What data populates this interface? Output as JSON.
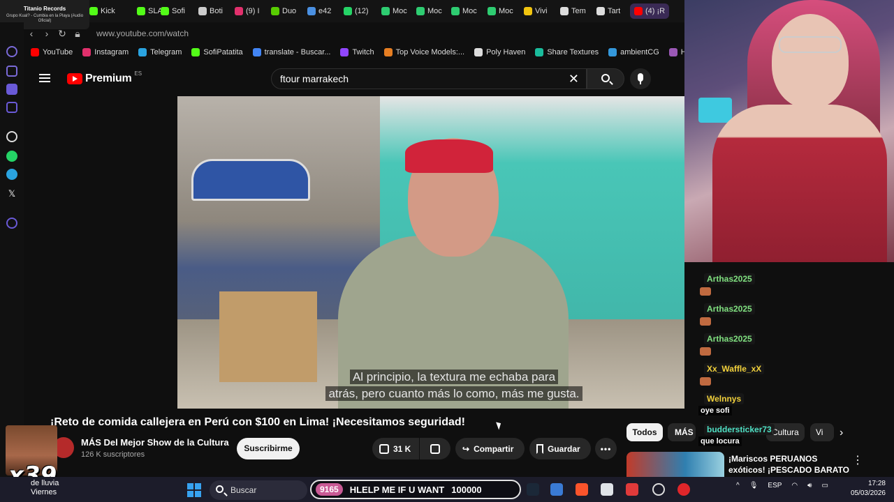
{
  "media_widget": {
    "title": "Titanio Records",
    "subtitle": "Grupo Kual? - Cumbia en la Playa (Audio Oficial)"
  },
  "tabs": [
    {
      "label": "Kick",
      "color": "#53fc18"
    },
    {
      "label": "SLA",
      "color": "#53fc18"
    },
    {
      "label": "Sofi",
      "color": "#53fc18"
    },
    {
      "label": "Boti",
      "color": "#cccccc"
    },
    {
      "label": "(9) I",
      "color": "#e1306c"
    },
    {
      "label": "Duo",
      "color": "#58cc02"
    },
    {
      "label": "e42",
      "color": "#4a90e2"
    },
    {
      "label": "(12)",
      "color": "#25d366"
    },
    {
      "label": "Moc",
      "color": "#2ecc71"
    },
    {
      "label": "Moc",
      "color": "#2ecc71"
    },
    {
      "label": "Moc",
      "color": "#2ecc71"
    },
    {
      "label": "Moc",
      "color": "#2ecc71"
    },
    {
      "label": "Vivi",
      "color": "#f1c40f"
    },
    {
      "label": "Tem",
      "color": "#dddddd"
    },
    {
      "label": "Tart",
      "color": "#dddddd"
    },
    {
      "label": "(4) ¡R",
      "color": "#ff0000",
      "active": true
    }
  ],
  "address": {
    "url": "www.youtube.com/watch"
  },
  "bookmarks": [
    {
      "label": "YouTube",
      "color": "#ff0000"
    },
    {
      "label": "Instagram",
      "color": "#e1306c"
    },
    {
      "label": "Telegram",
      "color": "#2aa3e0"
    },
    {
      "label": "SofiPatatita",
      "color": "#53fc18"
    },
    {
      "label": "translate - Buscar...",
      "color": "#4285f4"
    },
    {
      "label": "Twitch",
      "color": "#9146ff"
    },
    {
      "label": "Top Voice Models:...",
      "color": "#e67e22"
    },
    {
      "label": "Poly Haven",
      "color": "#dddddd"
    },
    {
      "label": "Share Textures",
      "color": "#1abc9c"
    },
    {
      "label": "ambientCG",
      "color": "#3498db"
    },
    {
      "label": "Ha",
      "color": "#9b59b6"
    }
  ],
  "youtube": {
    "logo_text": "Premium",
    "region": "ES",
    "search_value": "ftour marrakech",
    "subtitle_line1": "Al principio, la textura me echaba para",
    "subtitle_line2": "atrás, pero cuanto más lo como, más me gusta.",
    "video_title": "¡Reto de comida callejera en Perú con $100 en Lima! ¡Necesitamos seguridad!",
    "channel_name": "MÁS Del Mejor Show de la Cultura",
    "subscriber_count": "126 K suscriptores",
    "subscribe_label": "Suscribirme",
    "like_count": "31 K",
    "share_label": "Compartir",
    "save_label": "Guardar",
    "more_label": "•••",
    "chips": {
      "all": "Todos",
      "mas": "MÁS De",
      "cultura": "Cultura",
      "vi": "Vi"
    },
    "rec_title": "¡Mariscos PERUANOS exóticos! ¡PESCADO BARATO vs caro de..."
  },
  "chat": [
    {
      "user": "Arthas2025",
      "color": "#7fe07f",
      "message": ""
    },
    {
      "user": "Arthas2025",
      "color": "#7fe07f",
      "message": ""
    },
    {
      "user": "Arthas2025",
      "color": "#7fe07f",
      "message": ""
    },
    {
      "user": "Xx_Waffle_xX",
      "color": "#f2d13b",
      "message": ""
    },
    {
      "user": "Welnnys",
      "color": "#f2d13b",
      "message": "oye sofi"
    },
    {
      "user": "buddersticker73",
      "color": "#4fe0c4",
      "message": "que locura"
    }
  ],
  "overlay": {
    "combo": "x39"
  },
  "taskbar": {
    "weather_line1": "de lluvia",
    "weather_line2": "Viernes",
    "search_label": "Buscar",
    "alert_count": "9165",
    "alert_text": "HLELP ME IF U WANT",
    "alert_goal": "100000",
    "language": "ESP",
    "time": "17:28",
    "date": "05/03/2026"
  }
}
